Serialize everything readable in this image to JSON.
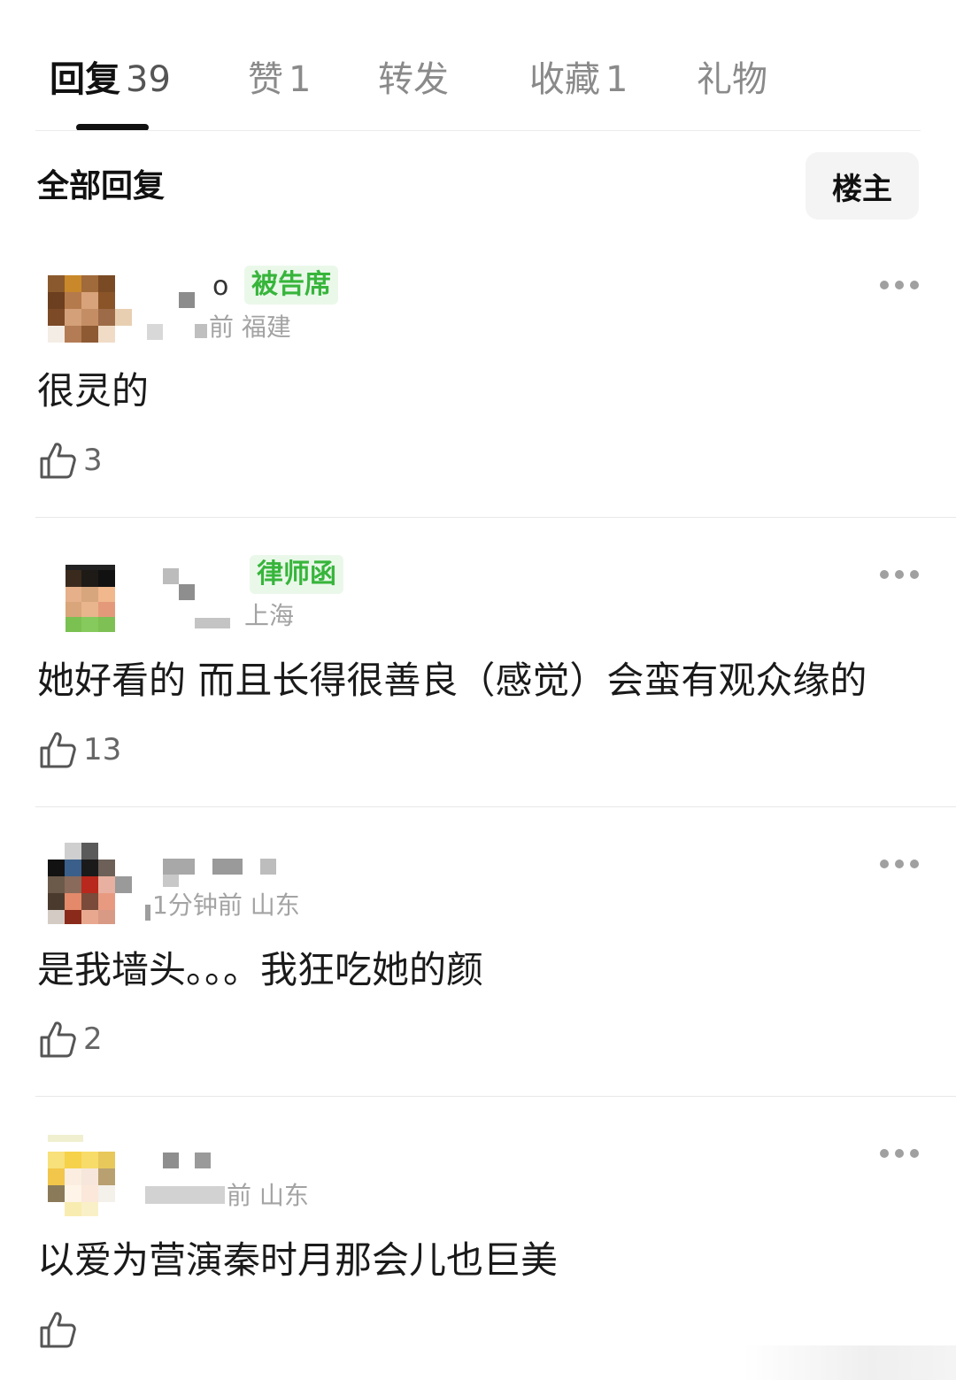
{
  "tabs": [
    {
      "label": "回复",
      "count": "39"
    },
    {
      "label": "赞",
      "count": "1"
    },
    {
      "label": "转发",
      "count": ""
    },
    {
      "label": "收藏",
      "count": "1"
    },
    {
      "label": "礼物",
      "count": ""
    }
  ],
  "section": {
    "title": "全部回复",
    "filter_label": "楼主"
  },
  "comments": [
    {
      "name_visible": "o",
      "badge": "被告席",
      "meta": "前 福建",
      "text": "很灵的",
      "likes": "3"
    },
    {
      "name_visible": "",
      "badge": "律师函",
      "meta": "上海",
      "text": "她好看的 而且长得很善良（感觉）会蛮有观众缘的",
      "likes": "13"
    },
    {
      "name_visible": "",
      "badge": "",
      "meta": "1分钟前 山东",
      "text": "是我墙头。。。我狂吃她的颜",
      "likes": "2"
    },
    {
      "name_visible": "",
      "badge": "",
      "meta": "前 山东",
      "text": "以爱为营演秦时月那会儿也巨美",
      "likes": ""
    }
  ],
  "colors": {
    "badge_green": "#37b53b",
    "badge_bg": "#eaf8ea",
    "muted": "#a3a3a3"
  },
  "icons": {
    "like": "thumbs-up-icon",
    "more": "more-dots-icon"
  }
}
